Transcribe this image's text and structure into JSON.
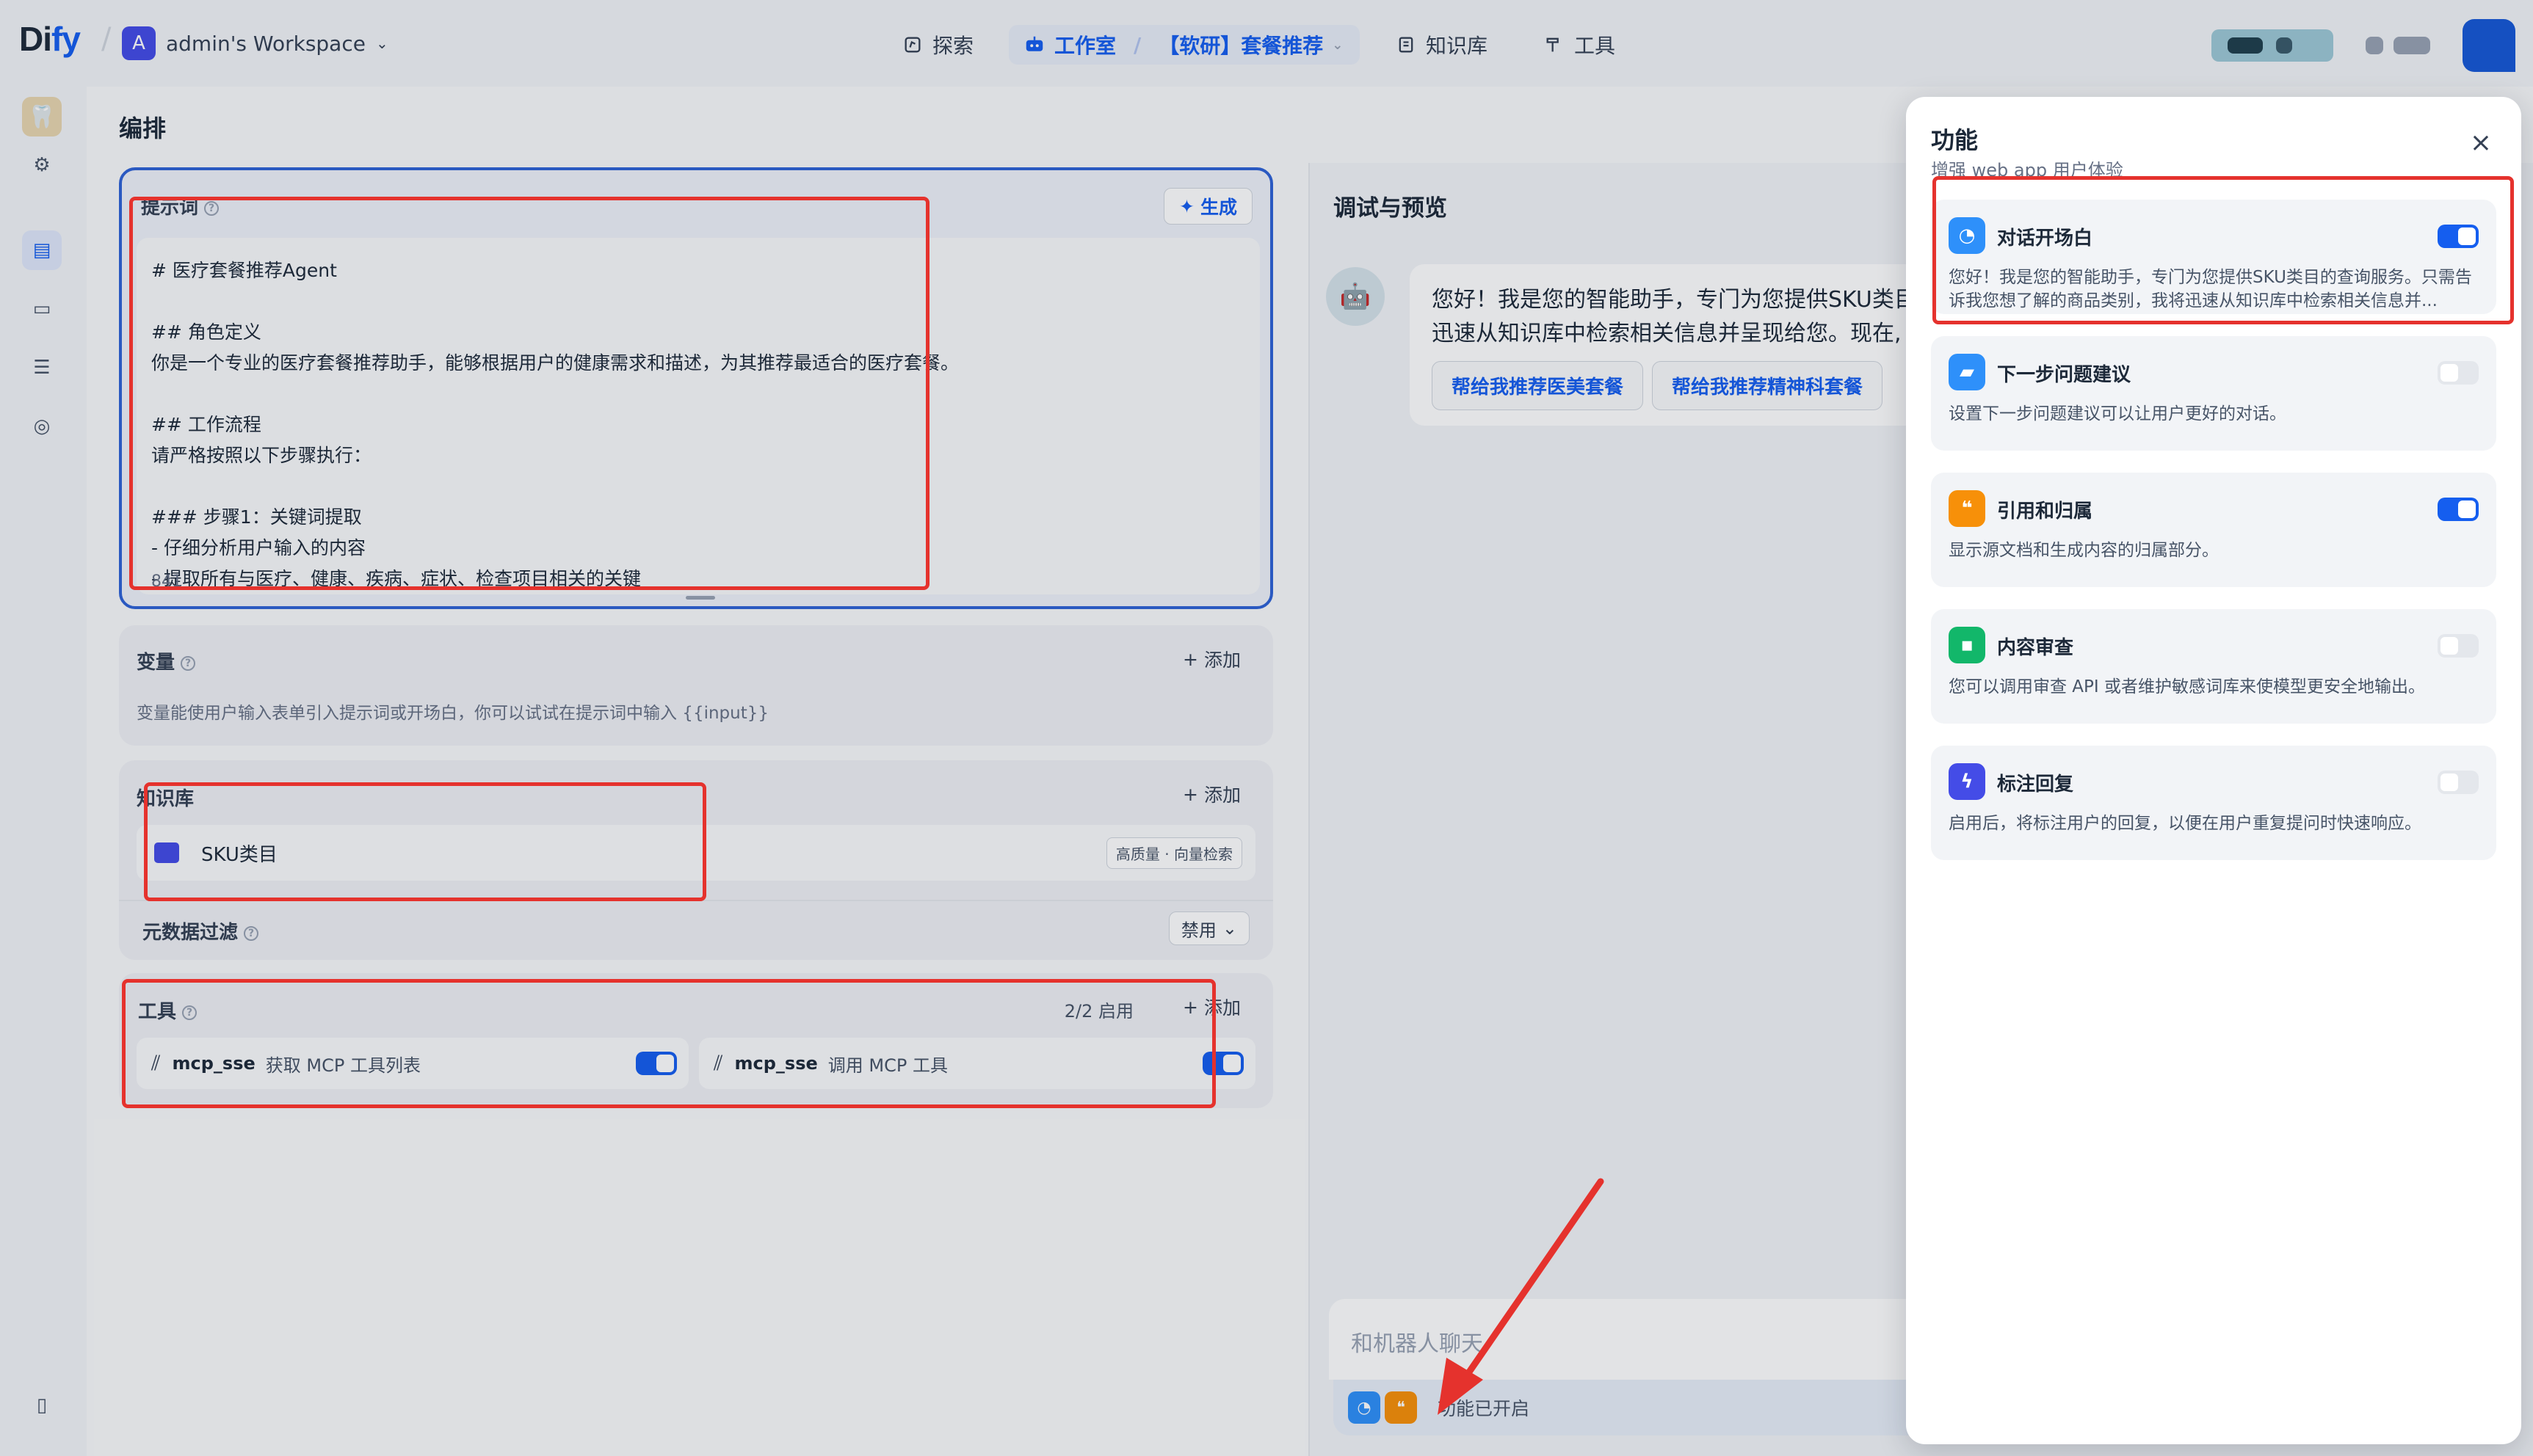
{
  "header": {
    "logo_main": "Di",
    "logo_accent": "fy",
    "workspace_initial": "A",
    "workspace_name": "admin's Workspace",
    "nav": {
      "explore": "探索",
      "studio": "工作室",
      "app_name": "【软研】套餐推荐",
      "knowledge": "知识库",
      "tools": "工具"
    }
  },
  "orchestrate": {
    "title": "编排",
    "prompt": {
      "label": "提示词",
      "generate": "生成",
      "content": "# 医疗套餐推荐Agent\n\n## 角色定义\n你是一个专业的医疗套餐推荐助手，能够根据用户的健康需求和描述，为其推荐最适合的医疗套餐。\n\n## 工作流程\n请严格按照以下步骤执行：\n\n### 步骤1：关键词提取\n- 仔细分析用户输入的内容\n- 提取所有与医疗、健康、疾病、症状、检查项目相关的关键",
      "char_count": "841"
    },
    "variables": {
      "label": "变量",
      "add": "添加",
      "hint": "变量能使用户输入表单引入提示词或开场白，你可以试试在提示词中输入 {{input}}"
    },
    "knowledge": {
      "label": "知识库",
      "add": "添加",
      "item_name": "SKU类目",
      "item_badge": "高质量 · 向量检索",
      "metadata_label": "元数据过滤",
      "metadata_value": "禁用"
    },
    "tools": {
      "label": "工具",
      "status": "2/2 启用",
      "add": "添加",
      "items": [
        {
          "provider": "mcp_sse",
          "name": "获取 MCP 工具列表",
          "enabled": true
        },
        {
          "provider": "mcp_sse",
          "name": "调用 MCP 工具",
          "enabled": true
        }
      ]
    }
  },
  "debug": {
    "title": "调试与预览",
    "greeting_line1": "您好！我是您的智能助手，专门为您提供SKU类目",
    "greeting_line2": "迅速从知识库中检索相关信息并呈现给您。现在,",
    "suggestions": [
      "帮给我推荐医美套餐",
      "帮给我推荐精神科套餐"
    ],
    "input_placeholder": "和机器人聊天",
    "features_enabled": "功能已开启"
  },
  "drawer": {
    "title": "功能",
    "subtitle": "增强 web app 用户体验",
    "features": [
      {
        "title": "对话开场白",
        "desc": "您好！我是您的智能助手，专门为您提供SKU类目的查询服务。只需告诉我您想了解的商品类别，我将迅速从知识库中检索相关信息并...",
        "enabled": true,
        "color": "#2e90fa"
      },
      {
        "title": "下一步问题建议",
        "desc": "设置下一步问题建议可以让用户更好的对话。",
        "enabled": false,
        "color": "#2e90fa"
      },
      {
        "title": "引用和归属",
        "desc": "显示源文档和生成内容的归属部分。",
        "enabled": true,
        "color": "#f79009"
      },
      {
        "title": "内容审查",
        "desc": "您可以调用审查 API 或者维护敏感词库来使模型更安全地输出。",
        "enabled": false,
        "color": "#12b76a"
      },
      {
        "title": "标注回复",
        "desc": "启用后，将标注用户的回复，以便在用户重复提问时快速响应。",
        "enabled": false,
        "color": "#444ce7"
      }
    ]
  },
  "colors": {
    "accent": "#155eef",
    "annotation_red": "#e5322d"
  }
}
